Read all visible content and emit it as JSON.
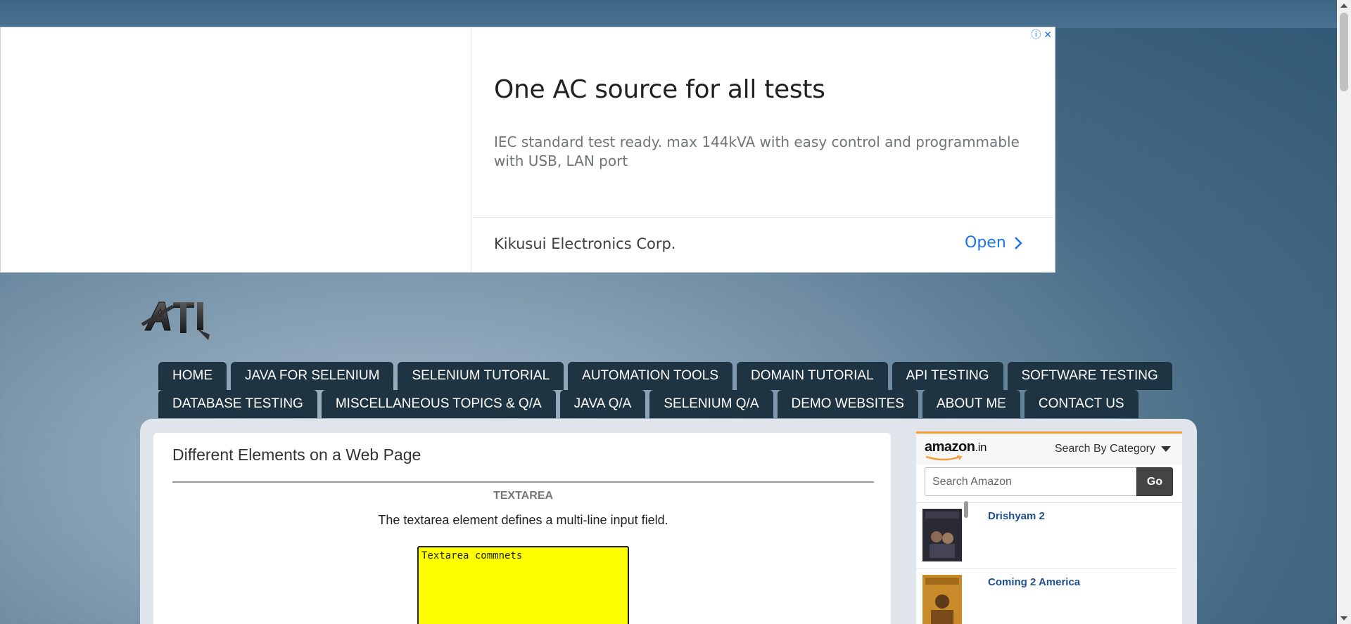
{
  "ad": {
    "headline": "One AC source for all tests",
    "body": "IEC standard test ready. max 144kVA with easy control and programmable with USB, LAN port",
    "advertiser": "Kikusui Electronics Corp.",
    "cta": "Open",
    "info_symbol": "ⓘ",
    "close_symbol": "✕"
  },
  "nav": {
    "row1": [
      "HOME",
      "JAVA FOR SELENIUM",
      "SELENIUM TUTORIAL",
      "AUTOMATION TOOLS",
      "DOMAIN TUTORIAL",
      "API TESTING",
      "SOFTWARE TESTING"
    ],
    "row2": [
      "DATABASE TESTING",
      "MISCELLANEOUS TOPICS & Q/A",
      "JAVA Q/A",
      "SELENIUM Q/A",
      "DEMO WEBSITES",
      "ABOUT ME",
      "CONTACT US"
    ]
  },
  "post": {
    "title": "Different Elements on a Web Page",
    "section_title": "TEXTAREA",
    "section_desc": "The textarea element defines a multi-line input field.",
    "textarea_value": "Textarea commnets"
  },
  "amazon": {
    "logo": "amazon",
    "logo_suffix": ".in",
    "category_label": "Search By Category",
    "search_placeholder": "Search Amazon",
    "go_label": "Go",
    "items": [
      {
        "title": "Drishyam 2"
      },
      {
        "title": "Coming 2 America"
      }
    ]
  },
  "colors": {
    "nav_bg": "#1e3442",
    "textarea_bg": "#ffff00",
    "amazon_accent": "#f29d38",
    "ad_cta": "#1a73e8"
  }
}
